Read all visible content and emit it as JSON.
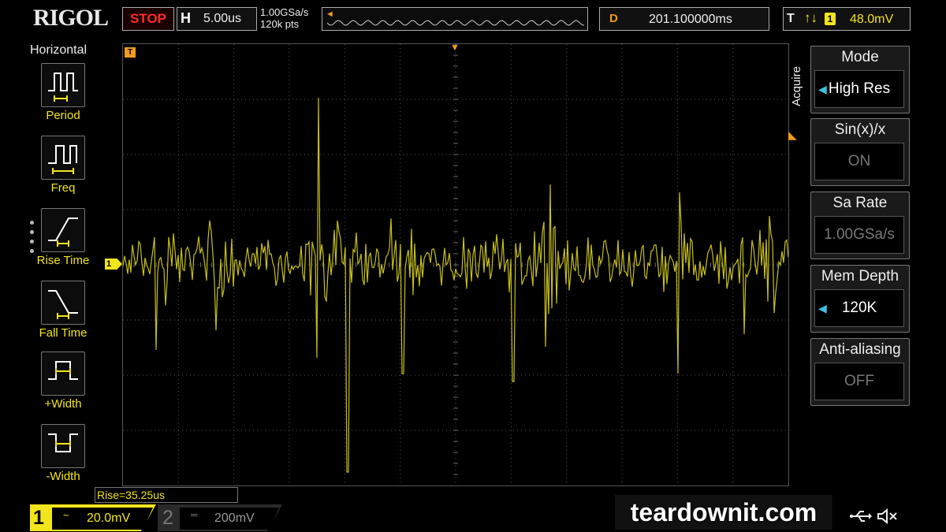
{
  "brand": "RIGOL",
  "run_state": "STOP",
  "timebase": {
    "label": "H",
    "value": "5.00us"
  },
  "acquisition": {
    "sample_rate": "1.00GSa/s",
    "memory_points": "120k pts"
  },
  "delay": {
    "label": "D",
    "value": "201.100000ms"
  },
  "trigger": {
    "label": "T",
    "edge_symbol": "↑↓",
    "channel": "1",
    "level": "48.0mV"
  },
  "grid_markers": {
    "t_marker": "T",
    "ch1_marker": "1"
  },
  "left_menu": {
    "title": "Horizontal",
    "items": [
      {
        "label": "Period",
        "icon": "period-icon"
      },
      {
        "label": "Freq",
        "icon": "frequency-icon"
      },
      {
        "label": "Rise Time",
        "icon": "rise-time-icon"
      },
      {
        "label": "Fall Time",
        "icon": "fall-time-icon"
      },
      {
        "label": "+Width",
        "icon": "positive-width-icon"
      },
      {
        "label": "-Width",
        "icon": "negative-width-icon"
      }
    ]
  },
  "right_menu": {
    "group_label": "Acquire",
    "items": [
      {
        "title": "Mode",
        "value": "High Res",
        "state": "active"
      },
      {
        "title": "Sin(x)/x",
        "value": "ON",
        "state": "dim"
      },
      {
        "title": "Sa Rate",
        "value": "1.00GSa/s",
        "state": "dim"
      },
      {
        "title": "Mem Depth",
        "value": "120K",
        "state": "active"
      },
      {
        "title": "Anti-aliasing",
        "value": "OFF",
        "state": "dim"
      }
    ]
  },
  "measurement": {
    "readout": "Rise=35.25us"
  },
  "channels": [
    {
      "number": "1",
      "coupling_symbol": "~",
      "scale": "20.0mV",
      "color": "#f2e51d",
      "active": true
    },
    {
      "number": "2",
      "coupling_symbol": "═",
      "scale": "200mV",
      "color": "#777777",
      "active": false
    }
  ],
  "watermark": "teardownit.com",
  "colors": {
    "trace": "#c8c01a",
    "accent_orange": "#f29b1d",
    "ch1_yellow": "#f2e51d",
    "stop_red": "#ff2a2a"
  }
}
